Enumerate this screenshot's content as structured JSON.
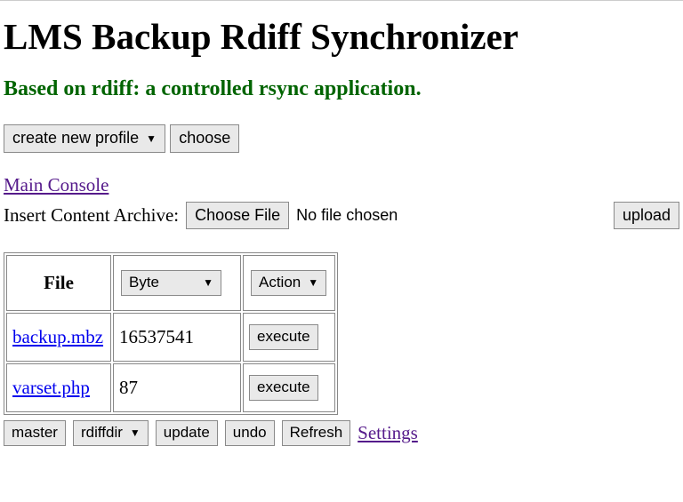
{
  "header": {
    "title": "LMS Backup Rdiff Synchronizer",
    "subtitle": "Based on rdiff: a controlled rsync application."
  },
  "top_toolbar": {
    "profile_select": "create new profile",
    "choose_button": "choose"
  },
  "nav": {
    "main_console": "Main Console"
  },
  "upload": {
    "label": "Insert Content Archive: ",
    "choose_file_button": "Choose File",
    "status": "No file chosen",
    "upload_button": "upload"
  },
  "table": {
    "headers": {
      "file": "File",
      "byte_select": "Byte",
      "action_select": "Action"
    },
    "rows": [
      {
        "file": "backup.mbz",
        "bytes": "16537541",
        "action": "execute"
      },
      {
        "file": "varset.php",
        "bytes": "87",
        "action": "execute"
      }
    ]
  },
  "bottom": {
    "master": "master",
    "rdiffdir_select": "rdiffdir",
    "update": "update",
    "undo": "undo",
    "refresh": "Refresh",
    "settings": "Settings"
  }
}
